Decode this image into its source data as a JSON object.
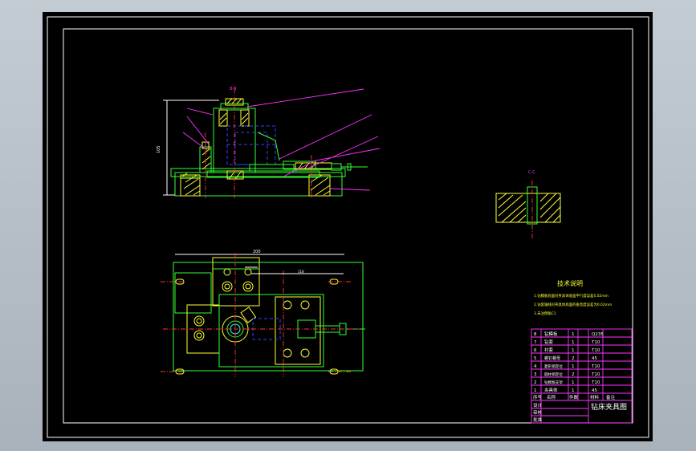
{
  "drawing": {
    "section_label_main": "B-B",
    "section_label_detail": "C-C",
    "dim_height": "105",
    "dim_width": "200",
    "dim_inner": "118",
    "tech_notes": {
      "title": "技术说明",
      "lines": [
        "1.钻模板底面对夹具体底面平行度误差0.02mm",
        "2.钻套轴线对夹具体底面的垂直度误差为0.02mm",
        "3.未注倒角C1"
      ]
    },
    "bom": {
      "rows": [
        {
          "no": "8",
          "name": "钻模板",
          "qty": "1",
          "mat": "Q235"
        },
        {
          "no": "7",
          "name": "钻套",
          "qty": "1",
          "mat": "T10"
        },
        {
          "no": "6",
          "name": "衬套",
          "qty": "1",
          "mat": "T10"
        },
        {
          "no": "5",
          "name": "螺钉螺母",
          "qty": "2",
          "mat": "45"
        },
        {
          "no": "4",
          "name": "菱形销定位",
          "qty": "1",
          "mat": "T10"
        },
        {
          "no": "3",
          "name": "圆柱销定位",
          "qty": "2",
          "mat": "T10"
        },
        {
          "no": "2",
          "name": "钻模板支架",
          "qty": "1",
          "mat": "T10"
        },
        {
          "no": "1",
          "name": "夹具体",
          "qty": "1",
          "mat": "45"
        }
      ],
      "header": [
        "序号",
        "名称",
        "件数",
        "材料",
        "备注"
      ],
      "title": "钻床夹具图",
      "signers": [
        "设计",
        "审核",
        "批准"
      ]
    }
  }
}
